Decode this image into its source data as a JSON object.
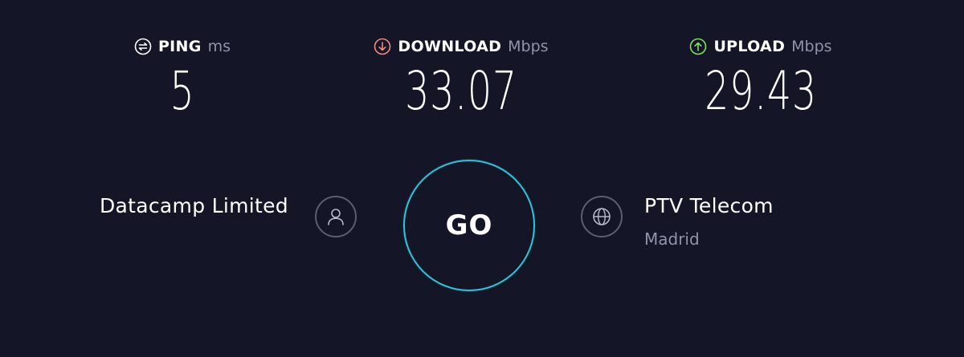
{
  "results": {
    "ping": {
      "label": "PING",
      "unit": "ms",
      "value": "5",
      "icon": "ping-icon"
    },
    "download": {
      "label": "DOWNLOAD",
      "unit": "Mbps",
      "value": "33.07",
      "icon": "download-arrow-icon"
    },
    "upload": {
      "label": "UPLOAD",
      "unit": "Mbps",
      "value": "29.43",
      "icon": "upload-arrow-icon"
    }
  },
  "go_button": {
    "label": "GO"
  },
  "isp": {
    "name": "Datacamp Limited",
    "icon": "user-icon"
  },
  "server": {
    "name": "PTV Telecom",
    "location": "Madrid",
    "icon": "globe-icon"
  },
  "colors": {
    "background": "#141526",
    "download_accent": "#f28b7d",
    "upload_accent": "#7de35a",
    "go_ring": "#2fc3d9",
    "muted_text": "#9193a8"
  }
}
